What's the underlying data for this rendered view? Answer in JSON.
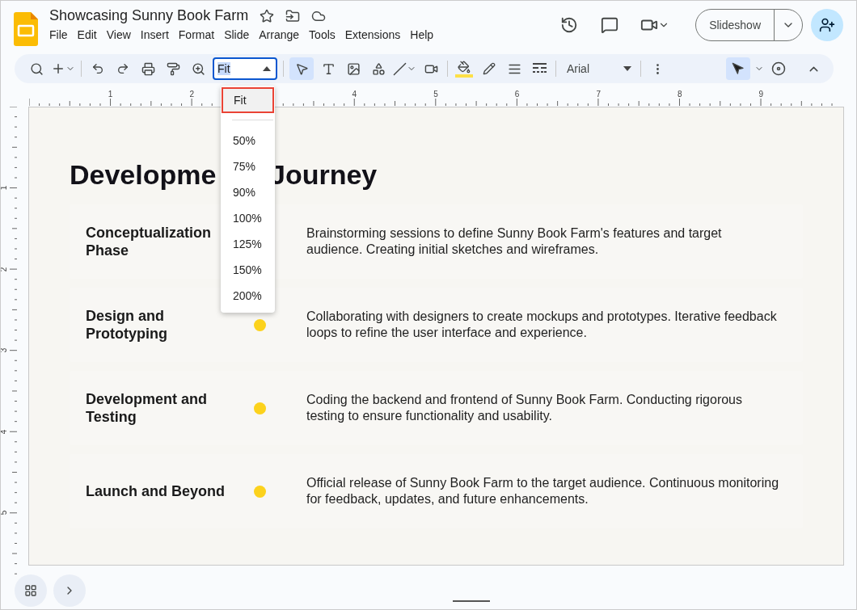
{
  "document": {
    "title": "Showcasing Sunny Book Farm"
  },
  "menu": [
    "File",
    "Edit",
    "View",
    "Insert",
    "Format",
    "Slide",
    "Arrange",
    "Tools",
    "Extensions",
    "Help"
  ],
  "header_buttons": {
    "slideshow": "Slideshow"
  },
  "toolbar": {
    "zoom_value": "Fit",
    "font": "Arial",
    "select_tool_active": true,
    "pointer_active": true
  },
  "zoom_menu": {
    "items": [
      {
        "label": "Fit",
        "selected": true
      },
      {
        "label": "50%",
        "selected": false
      },
      {
        "label": "75%",
        "selected": false
      },
      {
        "label": "90%",
        "selected": false
      },
      {
        "label": "100%",
        "selected": false
      },
      {
        "label": "125%",
        "selected": false
      },
      {
        "label": "150%",
        "selected": false
      },
      {
        "label": "200%",
        "selected": false
      }
    ]
  },
  "ruler": {
    "horizontal_labels": [
      "1",
      "2",
      "4",
      "5",
      "6",
      "7",
      "8",
      "9"
    ],
    "vertical_labels": [
      "1",
      "2",
      "3",
      "4",
      "5"
    ]
  },
  "slide": {
    "title_parts": [
      "Developme",
      "Journey"
    ],
    "rows": [
      {
        "phase": "Conceptualization Phase",
        "marker": false,
        "description": "Brainstorming sessions to define Sunny Book Farm's features and target audience. Creating initial sketches and wireframes."
      },
      {
        "phase": "Design and Prototyping",
        "marker": true,
        "description": "Collaborating with designers to create mockups and prototypes. Iterative feedback loops to refine the user interface and experience."
      },
      {
        "phase": "Development and Testing",
        "marker": true,
        "description": "Coding the backend and frontend of Sunny Book Farm. Conducting rigorous testing to ensure functionality and usability."
      },
      {
        "phase": "Launch and Beyond",
        "marker": true,
        "description": "Official release of Sunny Book Farm to the target audience. Continuous monitoring for feedback, updates, and future enhancements."
      }
    ]
  }
}
